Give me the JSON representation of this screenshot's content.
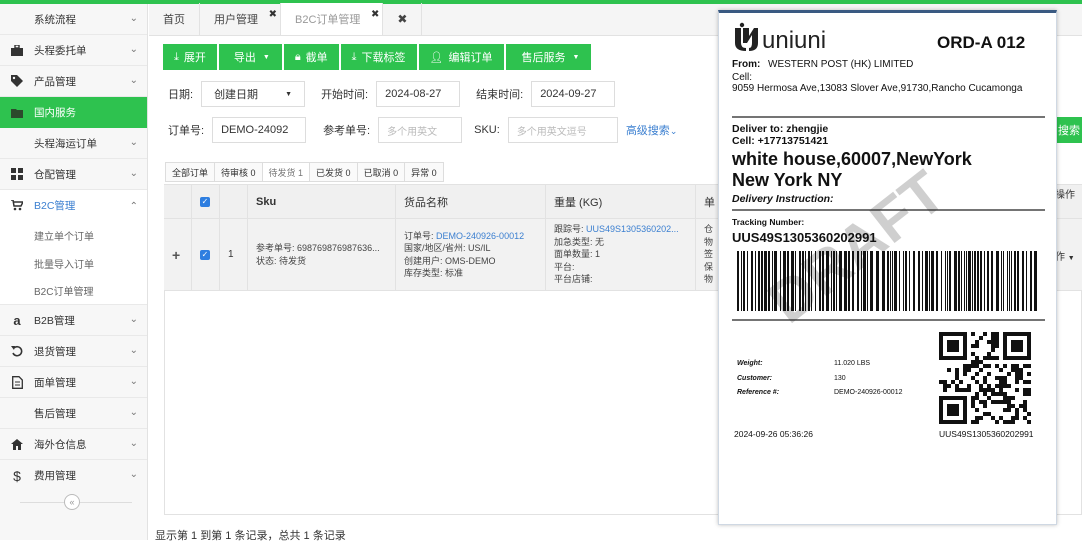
{
  "sidebar": {
    "items": [
      {
        "label": "系统流程",
        "icon": "none"
      },
      {
        "label": "头程委托单",
        "icon": "briefcase-icon"
      },
      {
        "label": "产品管理",
        "icon": "tag-icon"
      },
      {
        "label": "国内服务",
        "icon": "folder-icon"
      },
      {
        "label": "头程海运订单",
        "icon": "none"
      },
      {
        "label": "仓配管理",
        "icon": "grid-icon"
      },
      {
        "label": "B2C管理",
        "icon": "cart-icon"
      },
      {
        "label": "建立单个订单",
        "icon": "none"
      },
      {
        "label": "批量导入订单",
        "icon": "none"
      },
      {
        "label": "B2C订单管理",
        "icon": "none"
      },
      {
        "label": "B2B管理",
        "icon": "amazon-icon"
      },
      {
        "label": "退货管理",
        "icon": "return-icon"
      },
      {
        "label": "面单管理",
        "icon": "document-icon"
      },
      {
        "label": "售后管理",
        "icon": "none"
      },
      {
        "label": "海外仓信息",
        "icon": "home-icon"
      },
      {
        "label": "费用管理",
        "icon": "dollar-icon"
      }
    ],
    "collapse": "«"
  },
  "tabs": [
    {
      "label": "首页"
    },
    {
      "label": "用户管理"
    },
    {
      "label": "B2C订单管理"
    }
  ],
  "tab_close": "✖",
  "toolbar": {
    "expand": "展开",
    "export": "导出",
    "cut": "截单",
    "download_label": "下载标签",
    "edit_order": "编辑订单",
    "after_sales": "售后服务"
  },
  "filters": {
    "date_label": "日期:",
    "date_type": "创建日期",
    "start_label": "开始时间:",
    "start_value": "2024-08-27",
    "end_label": "结束时间:",
    "end_value": "2024-09-27",
    "order_label": "订单号:",
    "order_value": "DEMO-24092",
    "ref_label": "参考单号:",
    "ref_placeholder": "多个用英文",
    "sku_label": "SKU:",
    "sku_placeholder": "多个用英文逗号",
    "advanced": "高级搜索",
    "search": "搜索"
  },
  "status_tabs": [
    {
      "label": "全部订单"
    },
    {
      "label": "待审核 0"
    },
    {
      "label": "待发货 1"
    },
    {
      "label": "已发货 0"
    },
    {
      "label": "已取消 0"
    },
    {
      "label": "异常 0"
    }
  ],
  "table": {
    "headers": {
      "sku": "Sku",
      "goods": "货品名称",
      "weight": "重量 (KG)",
      "single": "单",
      "ops": "操作"
    },
    "row": {
      "expand": "+",
      "index": "1",
      "sku_ref": "参考单号: 698769876987636...",
      "sku_status": "状态: 待发货",
      "goods_order_label": "订单号:",
      "goods_order": "DEMO-240926-00012",
      "goods_country": "国家/地区/省州: US/IL",
      "goods_user": "创建用户: OMS-DEMO",
      "goods_stock": "库存类型: 标准",
      "trk_label": "跟踪号:",
      "trk": "UUS49S1305360202...",
      "add_type": "加急类型: 无",
      "face_qty": "面单数量: 1",
      "platform": "平台:",
      "platform_store": "平台店铺:",
      "extra": [
        "仓",
        "物",
        "签",
        "保",
        "物"
      ],
      "ops": "作"
    }
  },
  "footer": "显示第 1 到第 1 条记录，总共 1 条记录",
  "label": {
    "brand": "uniuni",
    "order_id": "ORD-A 012",
    "from_label": "From:",
    "from_name": "WESTERN POST (HK) LIMITED",
    "from_cell": "Cell:",
    "from_addr": "9059 Hermosa Ave,13083 Slover Ave,91730,Rancho Cucamonga",
    "deliver_label": "Deliver to: zhengjie",
    "cell_label": "Cell: +17713751421",
    "address1": "white house,60007,NewYork",
    "address2": "New York NY",
    "instruction": "Delivery Instruction:",
    "tracking_label": "Tracking Number:",
    "tracking": "UUS49S1305360202991",
    "weight_label": "Weight:",
    "weight": "11.020 LBS",
    "customer_label": "Customer:",
    "customer": "130",
    "reference_label": "Reference #:",
    "reference": "DEMO-240926-00012",
    "datetime": "2024-09-26 05:36:26",
    "tracking_small": "UUS49S1305360202991",
    "watermark": "DRAFT"
  }
}
